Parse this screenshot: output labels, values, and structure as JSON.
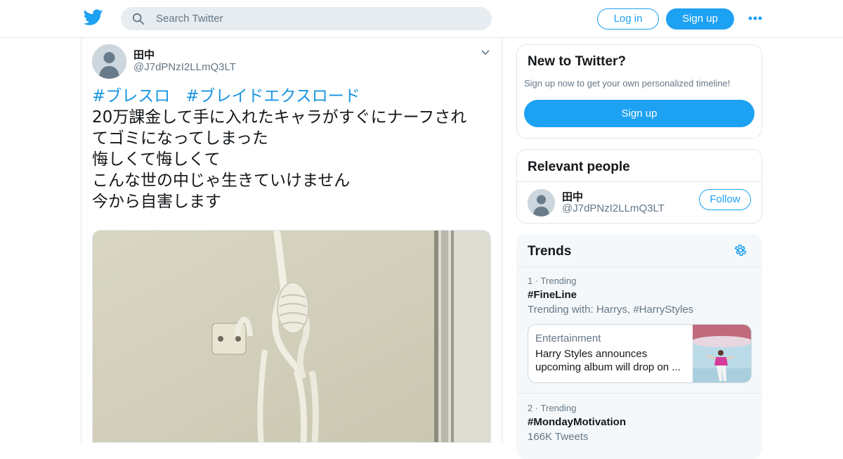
{
  "header": {
    "logo_icon": "twitter-bird-icon",
    "search_placeholder": "Search Twitter",
    "login_label": "Log in",
    "signup_label": "Sign up",
    "more_icon": "more-horizontal-icon"
  },
  "tweet": {
    "display_name": "田中",
    "handle": "@J7dPNzI2LLmQ3LT",
    "hashtags": [
      "#ブレスロ",
      "#ブレイドエクスロード"
    ],
    "lines": [
      "20万課金して手に入れたキャラがすぐにナーフされ",
      "てゴミになってしまった",
      "悔しくて悔しくて",
      "こんな世の中じゃ生きていけません",
      "今から自害します"
    ],
    "media_icon": "photo-rope-image"
  },
  "new_to_twitter": {
    "title": "New to Twitter?",
    "subtitle": "Sign up now to get your own personalized timeline!",
    "signup_label": "Sign up"
  },
  "relevant_people": {
    "title": "Relevant people",
    "name": "田中",
    "handle": "@J7dPNzI2LLmQ3LT",
    "follow_label": "Follow"
  },
  "trends": {
    "title": "Trends",
    "items": [
      {
        "rank": "1 · Trending",
        "name": "#FineLine",
        "sub": "Trending with: Harrys, #HarryStyles",
        "news": {
          "category": "Entertainment",
          "headline": "Harry Styles announces upcoming album will drop on ..."
        }
      },
      {
        "rank": "2 · Trending",
        "name": "#MondayMotivation",
        "sub": "166K Tweets"
      }
    ]
  },
  "colors": {
    "brand": "#1da1f2",
    "hashtag": "#1b95e0",
    "secondary_text": "#657786",
    "border": "#e1e8ed"
  }
}
